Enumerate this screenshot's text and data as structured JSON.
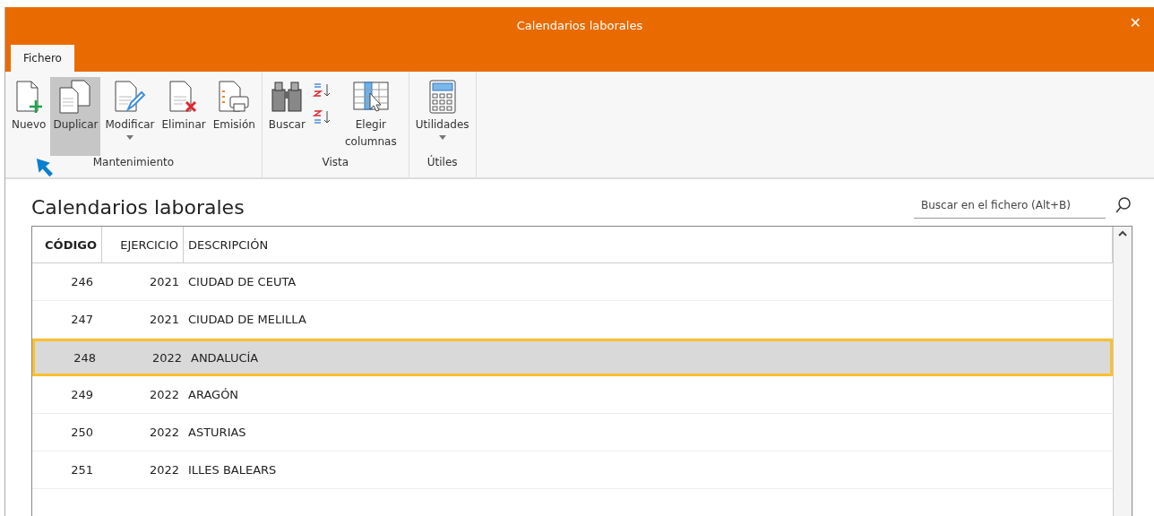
{
  "window": {
    "title": "Calendarios laborales",
    "close": "✕"
  },
  "tabs": [
    {
      "label": "Fichero",
      "selected": true
    }
  ],
  "ribbon": {
    "groups": [
      {
        "label": "Mantenimiento",
        "buttons": [
          {
            "label": "Nuevo",
            "selected": false,
            "dropdown": false
          },
          {
            "label": "Duplicar",
            "selected": true,
            "dropdown": false
          },
          {
            "label": "Modificar",
            "selected": false,
            "dropdown": true
          },
          {
            "label": "Eliminar",
            "selected": false,
            "dropdown": false
          },
          {
            "label": "Emisión",
            "selected": false,
            "dropdown": false
          }
        ]
      },
      {
        "label": "Vista",
        "buttons": [
          {
            "label": "Buscar",
            "selected": false,
            "dropdown": false
          },
          {
            "selected": false,
            "dropdown": false
          },
          {
            "label": "Elegir columnas",
            "selected": false,
            "dropdown": false
          }
        ]
      },
      {
        "label": "Útiles",
        "buttons": [
          {
            "label": "Utilidades",
            "selected": false,
            "dropdown": true
          }
        ]
      }
    ]
  },
  "page": {
    "heading": "Calendarios laborales",
    "search": {
      "placeholder": "Buscar en el fichero (Alt+B)"
    }
  },
  "table": {
    "columns": [
      "CÓDIGO",
      "EJERCICIO",
      "DESCRIPCIÓN"
    ],
    "rows": [
      {
        "cells": [
          "246",
          "2021",
          "CIUDAD DE CEUTA"
        ],
        "selected": false
      },
      {
        "cells": [
          "247",
          "2021",
          "CIUDAD DE MELILLA"
        ],
        "selected": false
      },
      {
        "cells": [
          "248",
          "2022",
          "ANDALUCÍA"
        ],
        "selected": true
      },
      {
        "cells": [
          "249",
          "2022",
          "ARAGÓN"
        ],
        "selected": false
      },
      {
        "cells": [
          "250",
          "2022",
          "ASTURIAS"
        ],
        "selected": false
      },
      {
        "cells": [
          "251",
          "2022",
          "ILLES BALEARS"
        ],
        "selected": false
      }
    ]
  }
}
